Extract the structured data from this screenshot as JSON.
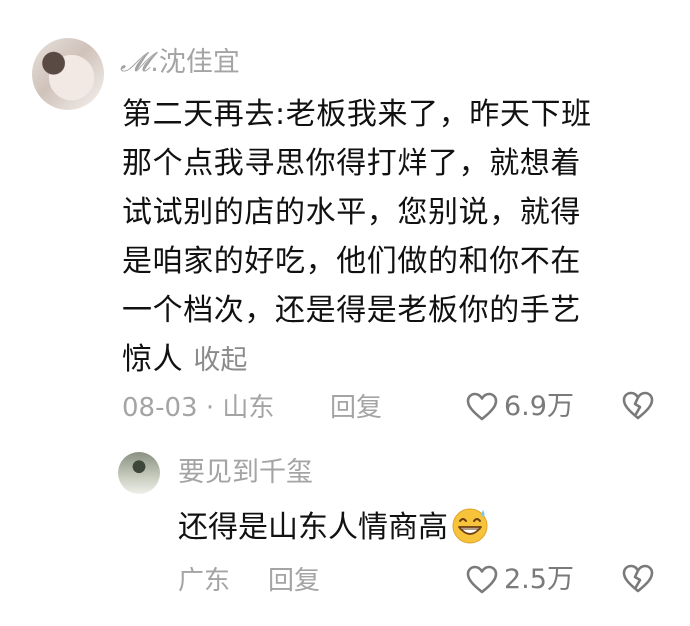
{
  "main_comment": {
    "username_prefix": "𝓜",
    "username": ".沈佳宜",
    "lines": [
      "第二天再去:老板我来了，昨天下班",
      "那个点我寻思你得打烊了，就想着",
      "试试别的店的水平，您别说，就得",
      "是咱家的好吃，他们做的和你不在",
      "一个档次，还是得是老板你的手艺",
      "惊人"
    ],
    "collapse_label": "收起",
    "date": "08-03",
    "separator": "·",
    "location": "山东",
    "reply_label": "回复",
    "like_count": "6.9万"
  },
  "reply": {
    "username": "要见到千玺",
    "text": "还得是山东人情商高",
    "emoji": "grinning-sweat-emoji",
    "location": "广东",
    "reply_label": "回复",
    "like_count": "2.5万"
  },
  "colors": {
    "text": "#111111",
    "muted": "#a4a4a4",
    "icon": "#7a7a7a",
    "emoji": "#f7c33b"
  }
}
